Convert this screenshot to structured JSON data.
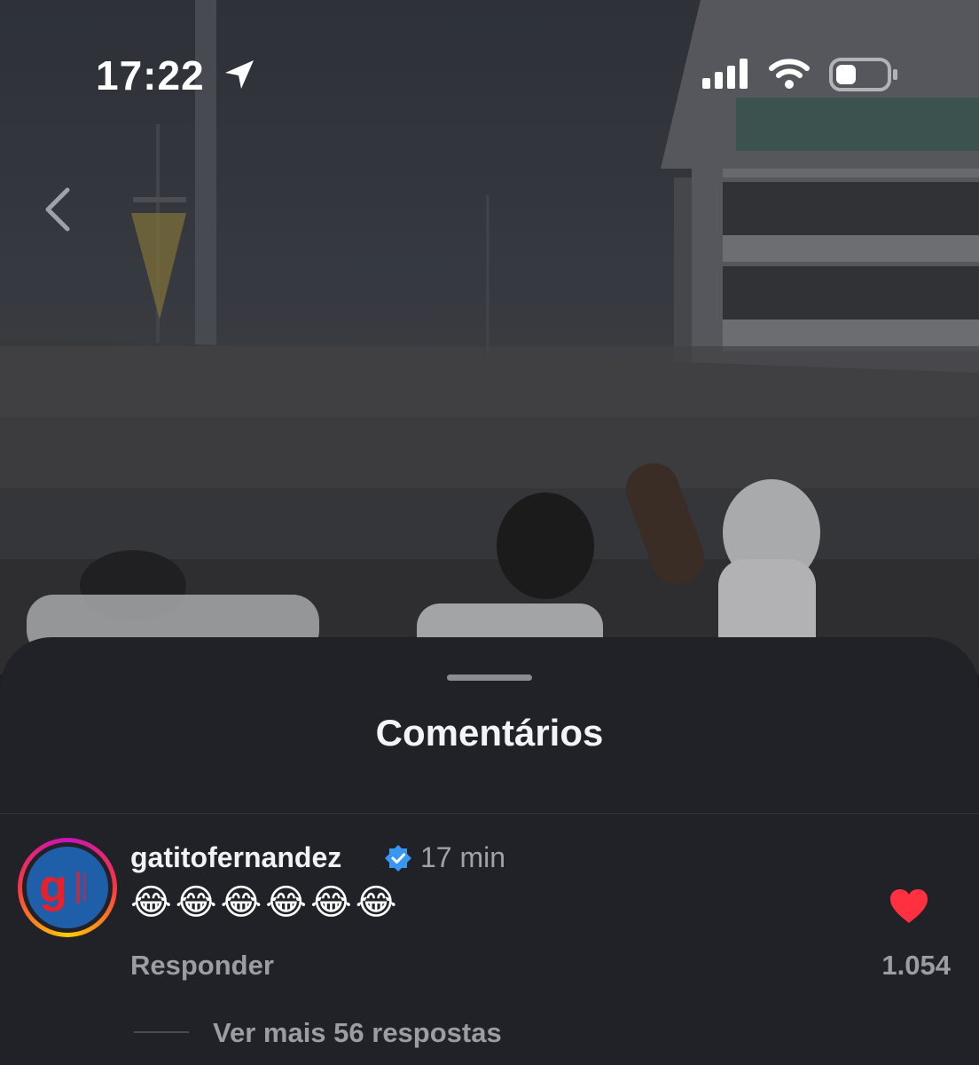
{
  "status_bar": {
    "time": "17:22",
    "icons": [
      "location-arrow-icon",
      "signal-icon",
      "wifi-icon",
      "battery-icon"
    ]
  },
  "navigation": {
    "back_icon": "chevron-left-icon"
  },
  "sheet": {
    "title": "Comentários"
  },
  "comment": {
    "username": "gatitofernandez",
    "verified": true,
    "time_ago": "17 min",
    "text": "😂😂😂😂😂😂",
    "liked": true,
    "like_count": "1.054",
    "reply_label": "Responder",
    "more_replies_label": "Ver mais 56 respostas"
  },
  "colors": {
    "sheet_bg": "#212228",
    "muted_text": "#9b9da3",
    "heart": "#ff3040",
    "verified": "#3897f0",
    "avatar_bg": "#1f5ea8",
    "avatar_logo": "#e8202a"
  }
}
